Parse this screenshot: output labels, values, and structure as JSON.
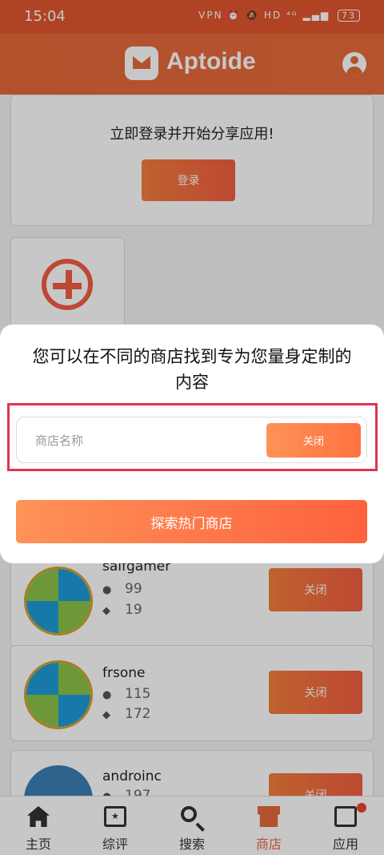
{
  "status_bar": {
    "time": "15:04",
    "icons": "VPN ⏰ 🔕 HD ⁴ᴳ ▂▄▆",
    "battery": "73"
  },
  "header": {
    "app_name": "Aptoide"
  },
  "login_card": {
    "text": "立即登录并开始分享应用!",
    "button": "登录"
  },
  "stores": [
    {
      "name": "saifgamer",
      "followers": "99",
      "apps": "19",
      "button": "关闭"
    },
    {
      "name": "frsone",
      "followers": "115",
      "apps": "172",
      "button": "关闭"
    },
    {
      "name": "androinc",
      "followers": "197",
      "button": "关闭"
    }
  ],
  "dialog": {
    "title": "您可以在不同的商店找到专为您量身定制的内容",
    "input_placeholder": "商店名称",
    "close_button": "关闭",
    "explore_button": "探索热门商店"
  },
  "bottom_nav": [
    {
      "label": "主页",
      "icon": "home-icon"
    },
    {
      "label": "综评",
      "icon": "review-icon"
    },
    {
      "label": "搜索",
      "icon": "search-icon"
    },
    {
      "label": "商店",
      "icon": "store-icon",
      "active": true
    },
    {
      "label": "应用",
      "icon": "apps-icon"
    }
  ],
  "colors": {
    "brand": "#e56a3a",
    "highlight": "#e0344f"
  }
}
